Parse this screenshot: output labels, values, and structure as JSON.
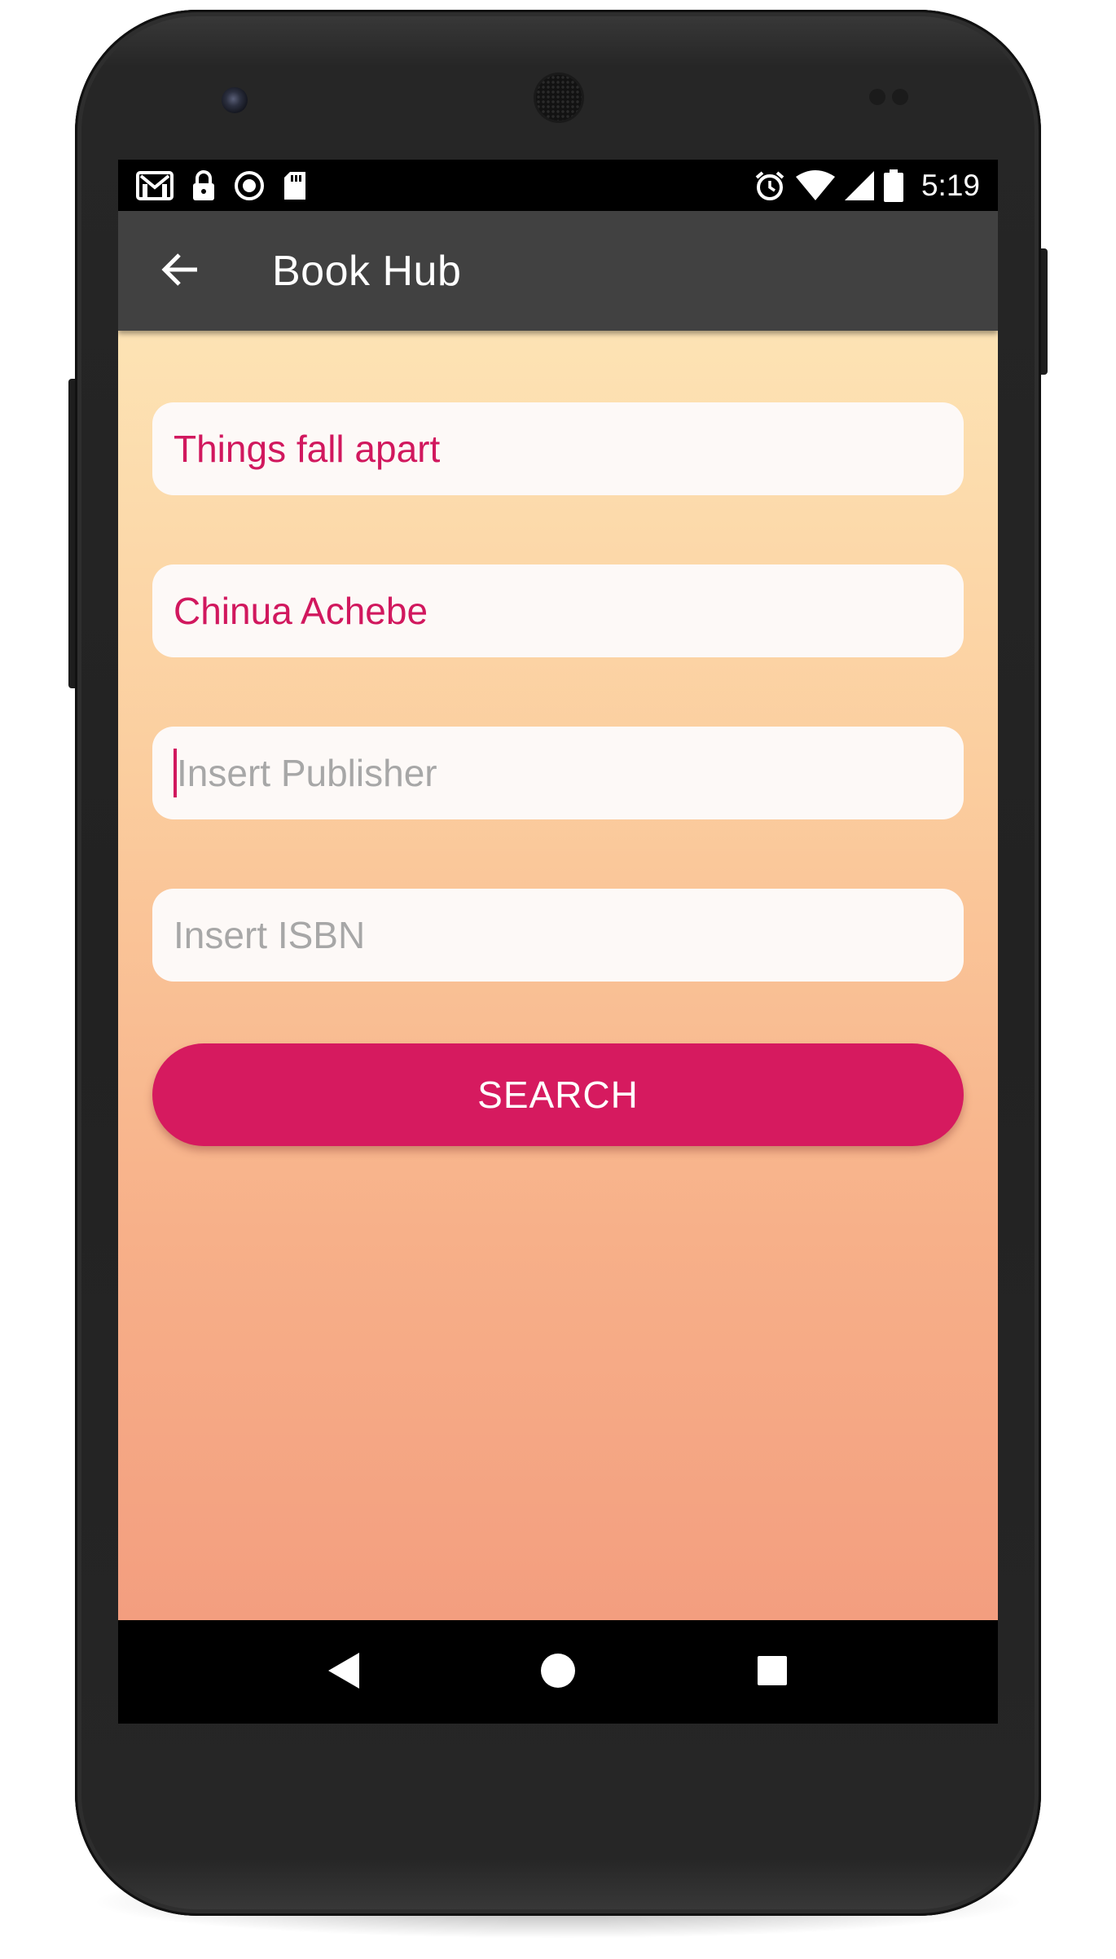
{
  "status_bar": {
    "time": "5:19",
    "left_icons": [
      "gmail-icon",
      "lock-icon",
      "sync-circle-icon",
      "sd-card-icon"
    ],
    "right_icons": [
      "alarm-icon",
      "wifi-icon",
      "signal-icon",
      "battery-icon"
    ]
  },
  "app_bar": {
    "title": "Book Hub",
    "back_icon": "arrow-back-icon"
  },
  "form": {
    "title_field": {
      "value": "Things fall apart"
    },
    "author_field": {
      "value": "Chinua Achebe"
    },
    "publisher_field": {
      "value": "",
      "placeholder": "Insert Publisher",
      "focused": true
    },
    "isbn_field": {
      "value": "",
      "placeholder": "Insert ISBN"
    },
    "search_label": "SEARCH"
  },
  "nav_bar": {
    "buttons": [
      "back-triangle-icon",
      "home-circle-icon",
      "recents-square-icon"
    ]
  },
  "colors": {
    "accent": "#d61a5f",
    "app_bar": "#414141",
    "gradient_top": "#fde3b4",
    "gradient_bottom": "#f39e7f",
    "field_bg": "#fdf9f7",
    "placeholder": "#a7a7a7"
  }
}
